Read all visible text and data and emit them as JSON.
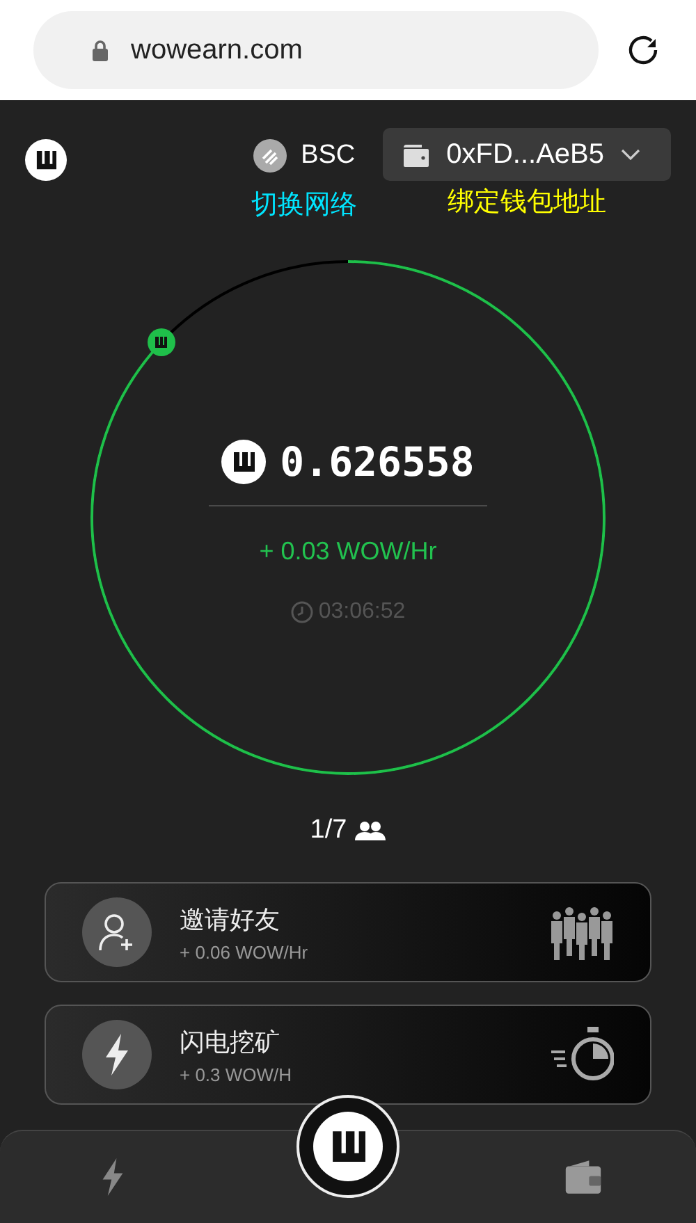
{
  "browser": {
    "url": "wowearn.com"
  },
  "header": {
    "network": "BSC",
    "wallet_address": "0xFD...AeB5",
    "network_hint": "切换网络",
    "wallet_hint": "绑定钱包地址"
  },
  "mining": {
    "balance": "0.626558",
    "rate": "+ 0.03 WOW/Hr",
    "countdown": "03:06:52"
  },
  "team": {
    "count": "1/7"
  },
  "tasks": [
    {
      "kind": "invite",
      "title": "邀请好友",
      "rate": "+ 0.06 WOW/Hr"
    },
    {
      "kind": "boost",
      "title": "闪电挖矿",
      "rate": "+ 0.3 WOW/H"
    }
  ],
  "nav": [
    {
      "kind": "boost"
    },
    {
      "kind": "home"
    },
    {
      "kind": "wallet"
    }
  ]
}
